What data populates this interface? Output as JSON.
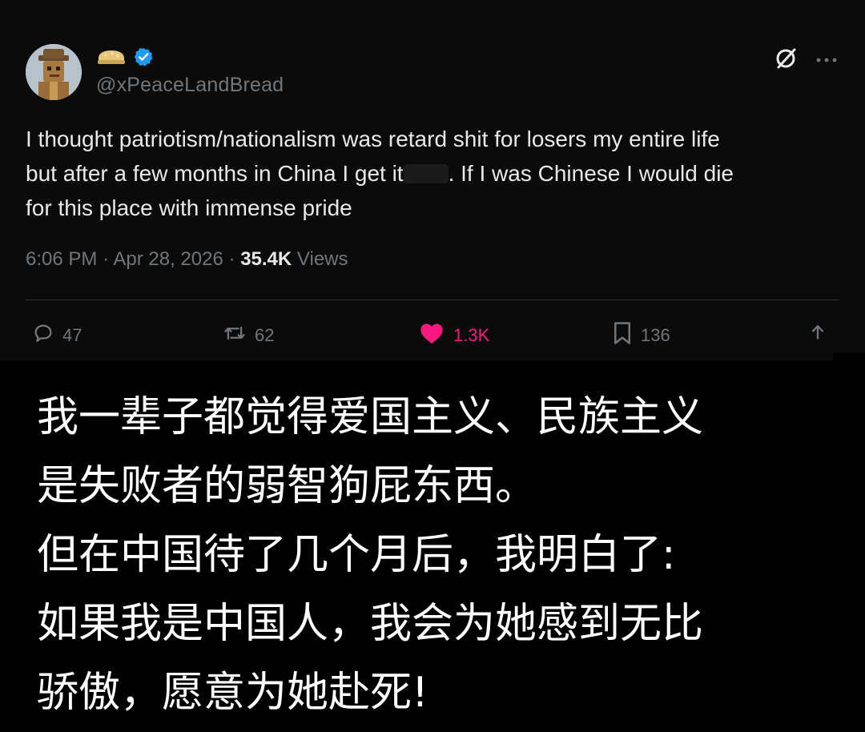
{
  "tweet": {
    "handle": "@xPeaceLandBread",
    "verified": true,
    "text": {
      "line1": "I thought patriotism/nationalism was retard shit for losers my entire life",
      "line2_before": "but after a few months in China I get it",
      "line2_after": ". If I was Chinese I would die",
      "line3": "for this place with immense pride"
    },
    "time": "6:06 PM",
    "separator": "·",
    "date": "Apr 28, 2026",
    "views_count": "35.4K",
    "views_label": "Views",
    "replies": "47",
    "reposts": "62",
    "likes": "1.3K",
    "bookmarks": "136",
    "icons": {
      "reply": "reply-icon",
      "repost": "repost-icon",
      "like": "heart-icon",
      "bookmark": "bookmark-icon",
      "share": "share-icon",
      "grok": "grok-icon",
      "more": "more-icon",
      "verified": "verified-badge-icon"
    },
    "colors": {
      "like": "#f91880",
      "verified": "#1d9bf0",
      "muted": "#71767b",
      "text": "#e7e9ea"
    }
  },
  "caption": {
    "line1": "我一辈子都觉得爱国主义、民族主义",
    "line2": "是失败者的弱智狗屁东西。",
    "line3": "但在中国待了几个月后，我明白了:",
    "line4": "如果我是中国人，我会为她感到无比",
    "line5": "骄傲，愿意为她赴死!"
  }
}
